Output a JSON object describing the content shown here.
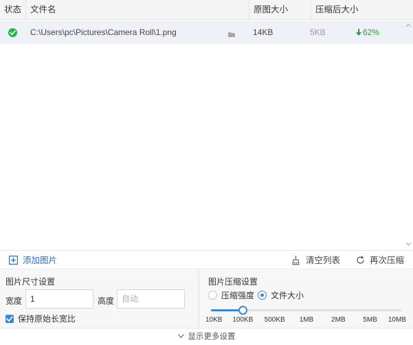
{
  "table": {
    "columns": [
      "状态",
      "文件名",
      "原图大小",
      "压缩后大小"
    ],
    "rows": [
      {
        "status_icon": "check-circle-icon",
        "path": "C:\\Users\\pc\\Pictures\\Camera Roll\\1.png",
        "original_size": "14KB",
        "compressed_size": "5KB",
        "ratio": "62%"
      }
    ]
  },
  "toolbar": {
    "add_label": "添加图片",
    "clear_label": "清空列表",
    "recompress_label": "再次压缩"
  },
  "size_settings": {
    "title": "图片尺寸设置",
    "width_label": "宽度",
    "width_value": "1",
    "height_label": "高度",
    "height_placeholder": "自动",
    "keep_ratio_label": "保持原始长宽比",
    "keep_ratio_checked": true
  },
  "compress_settings": {
    "title": "图片压缩设置",
    "mode_options": [
      "压缩强度",
      "文件大小"
    ],
    "selected_mode": "文件大小",
    "slider_ticks": [
      "10KB",
      "100KB",
      "500KB",
      "1MB",
      "2MB",
      "5MB",
      "10MB"
    ],
    "slider_value": "100KB"
  },
  "footer": {
    "more_label": "显示更多设置"
  },
  "colors": {
    "accent": "#3a86d8",
    "success": "#2ab34a",
    "link": "#2a6dc6"
  }
}
